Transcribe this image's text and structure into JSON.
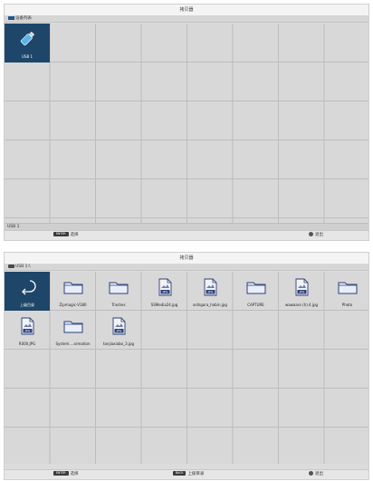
{
  "screen1": {
    "title": "拷贝器",
    "path": "设备列表",
    "device": {
      "label": "USB 1",
      "icon": "usb-stick-icon"
    },
    "status": "USB 1",
    "help": [
      {
        "key": "ENTER",
        "text": "选择"
      },
      {
        "key": "",
        "text": "退出"
      }
    ]
  },
  "screen2": {
    "title": "拷贝器",
    "path": "USB 1:\\",
    "items": [
      {
        "label": "上级目录",
        "icon": "return-arrow-icon",
        "type": "up"
      },
      {
        "label": "Zipmagic-V180",
        "icon": "folder-icon",
        "type": "folder"
      },
      {
        "label": "Trashes",
        "icon": "folder-icon",
        "type": "folder"
      },
      {
        "label": "SSMedia24.jpg",
        "icon": "jpeg-file-icon",
        "type": "file"
      },
      {
        "label": "ashigora_habin.jpg",
        "icon": "jpeg-file-icon",
        "type": "file"
      },
      {
        "label": "CAPTURE",
        "icon": "folder-icon",
        "type": "folder"
      },
      {
        "label": "wawaaro (h).4.jpg",
        "icon": "jpeg-file-icon",
        "type": "file"
      },
      {
        "label": "Photo",
        "icon": "folder-icon",
        "type": "folder"
      },
      {
        "label": "R000.JPG",
        "icon": "jpeg-file-icon",
        "type": "file"
      },
      {
        "label": "System....ormation",
        "icon": "folder-icon",
        "type": "folder"
      },
      {
        "label": "tanjiaxiabo_3.jpg",
        "icon": "jpeg-file-icon",
        "type": "file"
      }
    ],
    "help": [
      {
        "key": "ENTER",
        "text": "选择"
      },
      {
        "key": "BACK",
        "text": "上级目录"
      },
      {
        "key": "",
        "text": "退出"
      }
    ]
  },
  "colors": {
    "selected": "#1e4668",
    "grid_bg": "#d8d8d8",
    "grid_line": "#bdbdbd",
    "folder_fill": "#e9eef8",
    "folder_stroke": "#2b3f7a"
  }
}
